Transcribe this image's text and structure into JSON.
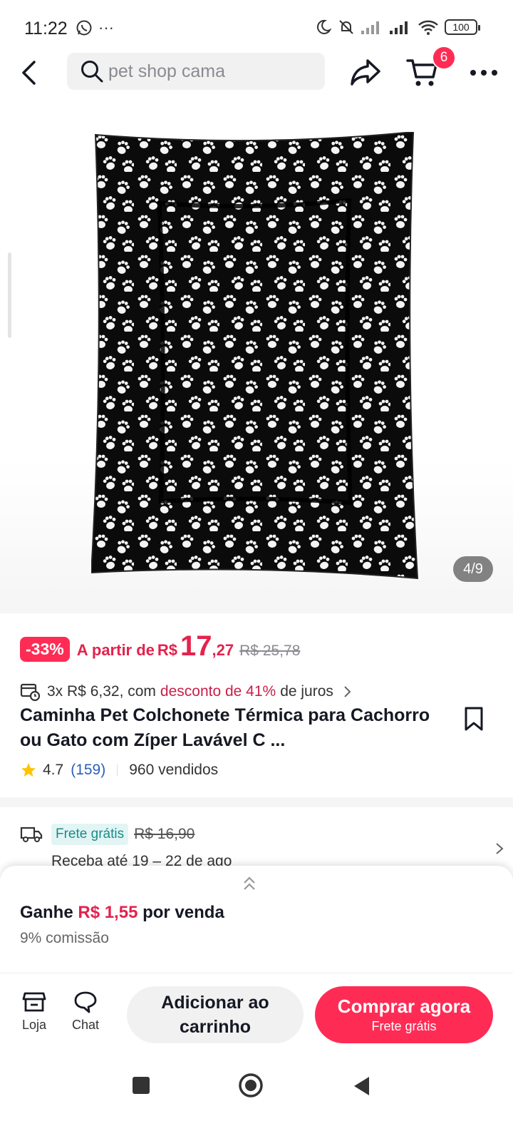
{
  "status_bar": {
    "time": "11:22",
    "more": "···",
    "battery": "100"
  },
  "nav": {
    "search_placeholder": "pet shop cama",
    "cart_count": "6"
  },
  "gallery": {
    "page_counter": "4/9"
  },
  "price": {
    "discount": "-33%",
    "prefix": "A partir de",
    "currency": "R$",
    "integer": "17",
    "decimals": ",27",
    "original": "R$ 25,78"
  },
  "installments": {
    "text_start": "3x R$ 6,32, com",
    "accent": "desconto de 41%",
    "text_end": "de juros"
  },
  "product": {
    "title": "Caminha Pet Colchonete Térmica para Cachorro ou Gato com Zíper Lavável C ...",
    "rating": "4.7",
    "review_count": "(159)",
    "sold": "960 vendidos"
  },
  "shipping": {
    "free_label": "Frete grátis",
    "old_price": "R$ 16,90",
    "delivery": "Receba até 19 – 22 de ago"
  },
  "commission": {
    "earn_prefix": "Ganhe",
    "earn_amount": "R$ 1,55",
    "earn_suffix": "por venda",
    "rate": "9% comissão"
  },
  "actions": {
    "shop_label": "Loja",
    "chat_label": "Chat",
    "add_to_cart": "Adicionar ao carrinho",
    "buy_now": "Comprar agora",
    "buy_sub": "Frete grátis"
  },
  "colors": {
    "accent": "#fe2c55",
    "price": "#e3224d",
    "free_tag_bg": "#e2f5f4",
    "free_tag_text": "#198c88",
    "link": "#2b5fb9"
  }
}
